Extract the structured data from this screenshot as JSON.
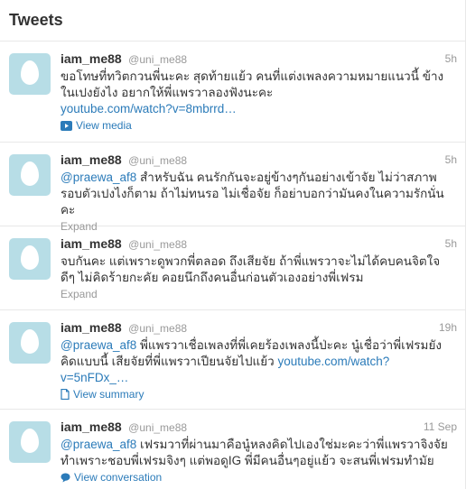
{
  "header": {
    "title": "Tweets"
  },
  "tweets": [
    {
      "fullname": "iam_me88",
      "username": "@uni_me88",
      "time": "5h",
      "mention": "",
      "text": "ขอโทษที่ทวิตกวนพี่นะคะ สุดท้ายแย้ว คนที่แต่งเพลงความหมายแนวนี้ ข้างในเปงยังไง อยากให้พี่แพรวาลองฟังนะคะ",
      "link": "youtube.com/watch?v=8mbrrd…",
      "expand_label": "View media",
      "expand_icon": "media-icon"
    },
    {
      "fullname": "iam_me88",
      "username": "@uni_me88",
      "time": "5h",
      "mention": "@praewa_af8",
      "text": " สำหรับฉัน คนรักกันจะอยู่ข้างๆกันอย่างเข้าจัย ไม่ว่าสภาพรอบตัวเปงไงก็ตาม ถ้าไม่ทนรอ ไม่เชื่อจัย ก็อย่าบอกว่ามันคงในความรักนั่นคะ",
      "link": "",
      "expand_label": "Expand",
      "expand_icon": ""
    },
    {
      "fullname": "iam_me88",
      "username": "@uni_me88",
      "time": "5h",
      "mention": "",
      "text": "จบกันคะ แต่เพราะดูพวกพี่ตลอด ถึงเสียจัย ถ้าพี่แพรวาจะไม่ได้คบคนจิตใจดีๆ ไม่คิดร้ายกะคัย คอยนึกถึงคนอื่นก่อนตัวเองอย่างพี่เฟรม",
      "link": "",
      "expand_label": "Expand",
      "expand_icon": ""
    },
    {
      "fullname": "iam_me88",
      "username": "@uni_me88",
      "time": "19h",
      "mention": "@praewa_af8",
      "text": " พี่แพรวาเชื่อเพลงที่พี่เคยร้องเพลงนี้ป่ะคะ นู๋เชื่อว่าพี่เฟรมยังคิดแบบนี้ เสียจัยที่พี่แพรวาเปียนจัยไปแย้ว ",
      "link": "youtube.com/watch?v=5nFDx_…",
      "expand_label": "View summary",
      "expand_icon": "summary-icon"
    },
    {
      "fullname": "iam_me88",
      "username": "@uni_me88",
      "time": "11 Sep",
      "mention": "@praewa_af8",
      "text": " เฟรมวาที่ผ่านมาคือนู๋หลงคิดไปเองใช่มะคะว่าพี่แพรวาจิงจัย ทำเพราะชอบพี่เฟรมจิงๆ แต่พอดูIG พี่มีคนอื่นๆอยู่แย้ว จะสนพี่เฟรมทำมัย",
      "link": "",
      "expand_label": "View conversation",
      "expand_icon": "conversation-icon"
    }
  ]
}
